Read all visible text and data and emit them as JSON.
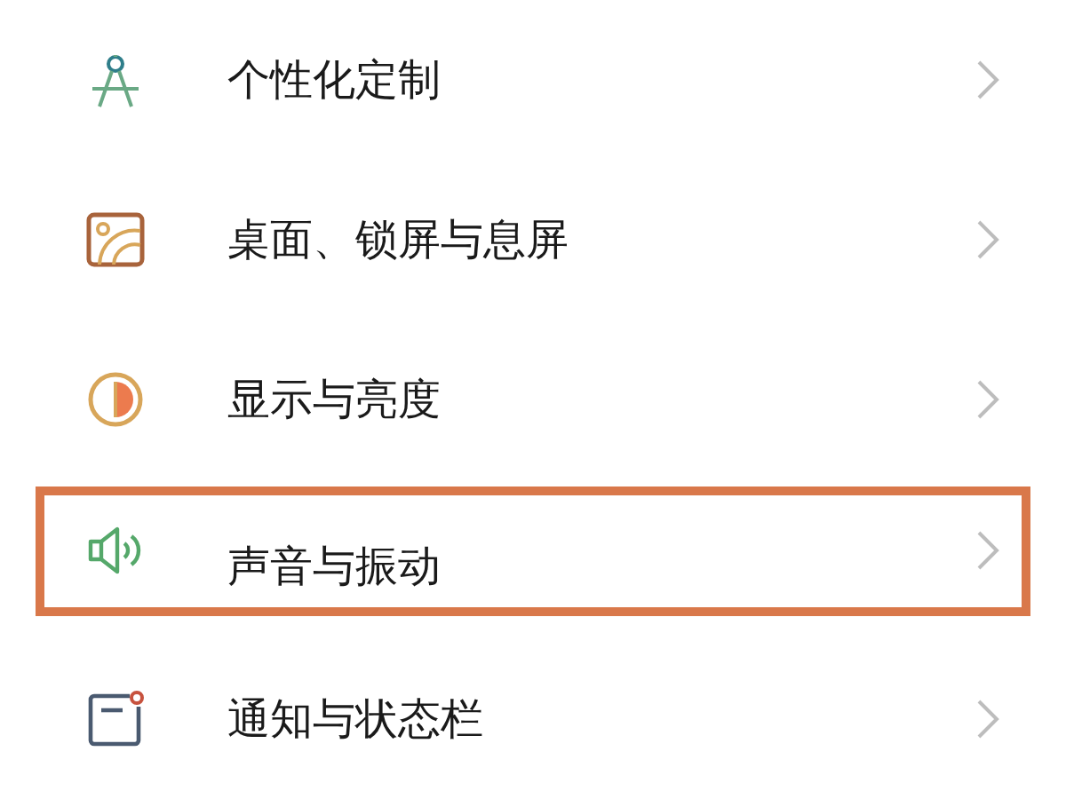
{
  "settings": [
    {
      "kind": "compass",
      "label": "个性化定制",
      "selected": false
    },
    {
      "kind": "wallpaper",
      "label": "桌面、锁屏与息屏",
      "selected": false
    },
    {
      "kind": "display",
      "label": "显示与亮度",
      "selected": false
    },
    {
      "kind": "sound",
      "label": "声音与振动",
      "selected": true
    },
    {
      "kind": "notification",
      "label": "通知与状态栏",
      "selected": false
    }
  ]
}
